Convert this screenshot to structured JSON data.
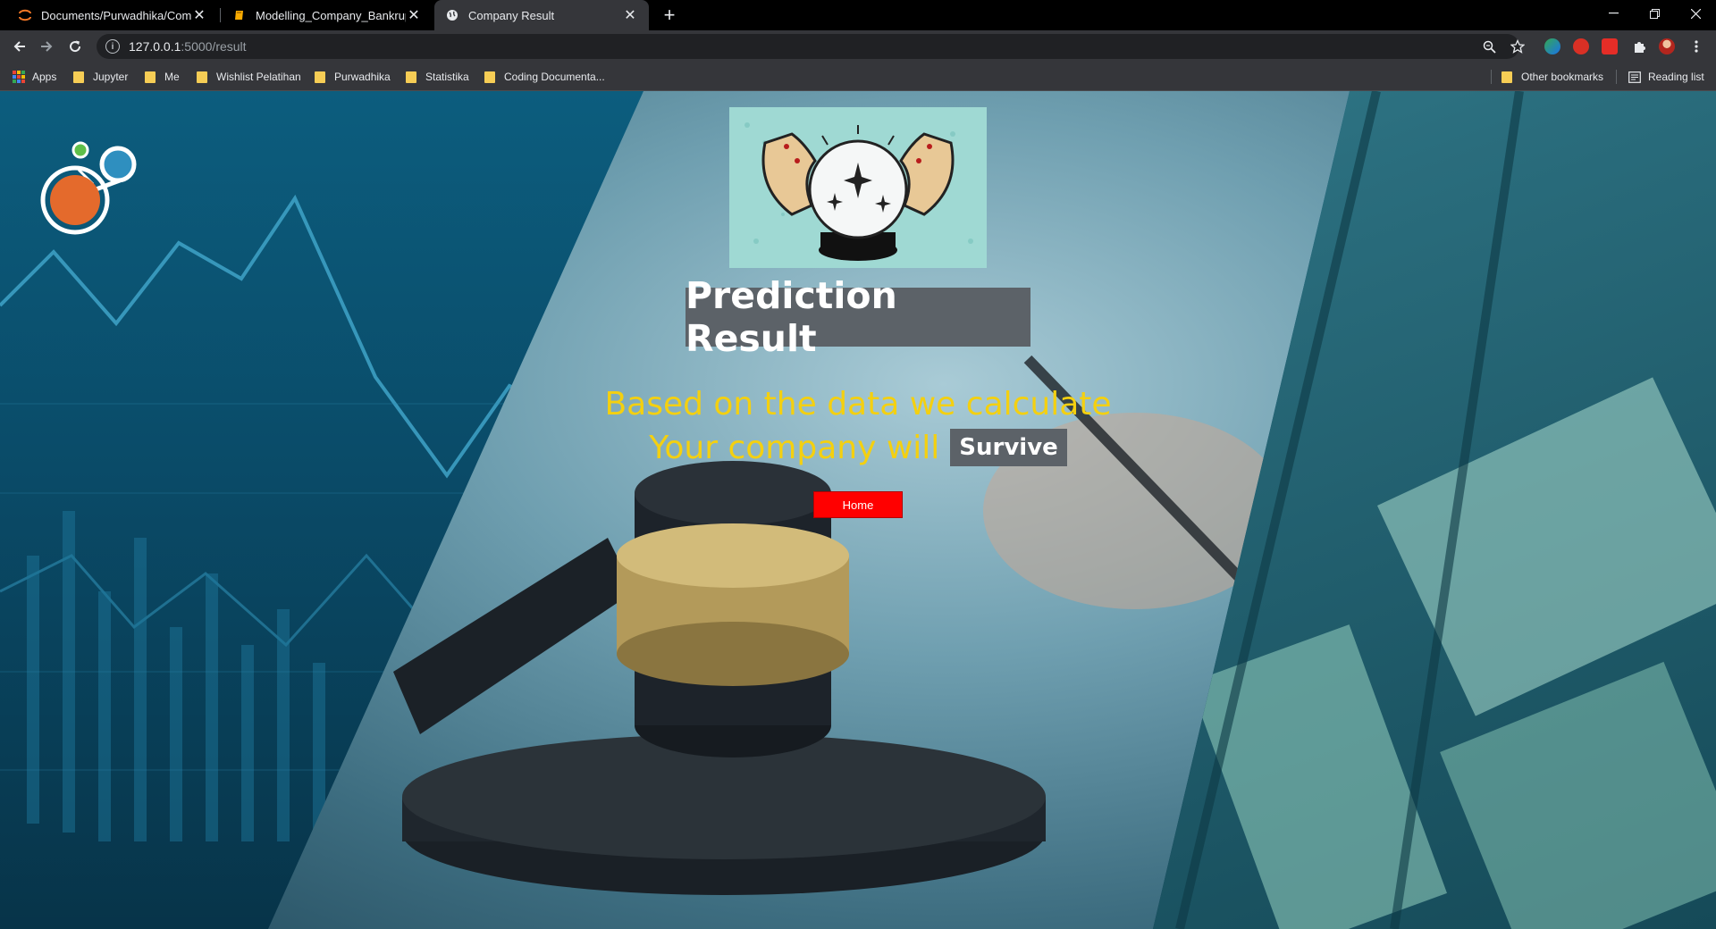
{
  "browser": {
    "tabs": [
      {
        "title": "Documents/Purwadhika/Compar",
        "icon": "jupyter-icon",
        "active": false
      },
      {
        "title": "Modelling_Company_Bankruptcy",
        "icon": "notebook-icon",
        "active": false
      },
      {
        "title": "Company Result",
        "icon": "globe-icon",
        "active": true
      }
    ],
    "new_tab": "+",
    "url_host": "127.0.0.1",
    "url_path": ":5000/result",
    "bookmarks": [
      "Apps",
      "Jupyter",
      "Me",
      "Wishlist Pelatihan",
      "Purwadhika",
      "Statistika",
      "Coding Documenta..."
    ],
    "other_bookmarks": "Other bookmarks",
    "reading_list": "Reading list"
  },
  "page": {
    "title": "Prediction Result",
    "line1": "Based on the data we calculate",
    "line2": "Your company will",
    "verdict": "Survive",
    "home_button": "Home"
  },
  "colors": {
    "accent_text": "#f4d010",
    "label_bg": "#5c6268",
    "home_button": "#ff0000"
  }
}
